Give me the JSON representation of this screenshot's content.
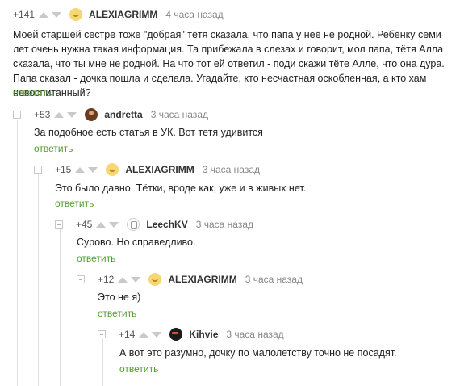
{
  "comments": [
    {
      "rating": "+141",
      "author": "ALEXIAGRIMM",
      "time": "4 часа назад",
      "text": "Моей старшей сестре тоже \"добрая\" тётя сказала, что папа у неё не родной. Ребёнку семи лет очень нужна такая информация. Та прибежала в слезах и говорит, мол папа, тётя Алла сказала, что ты мне не родной. На что тот ей ответил - поди скажи тёте Алле, что она дура. Папа сказал - дочка пошла и сделала. Угадайте, кто несчастная оскобленная, а кто хам невоспитанный?",
      "reply": "ответить"
    },
    {
      "rating": "+53",
      "author": "andretta",
      "time": "3 часа назад",
      "text": "За подобное есть статья в УК. Вот тетя удивится",
      "reply": "ответить"
    },
    {
      "rating": "+15",
      "author": "ALEXIAGRIMM",
      "time": "3 часа назад",
      "text": "Это было давно. Тётки, вроде как, уже и в живых нет.",
      "reply": "ответить"
    },
    {
      "rating": "+45",
      "author": "LeechKV",
      "time": "3 часа назад",
      "text": "Сурово. Но справедливо.",
      "reply": "ответить"
    },
    {
      "rating": "+12",
      "author": "ALEXIAGRIMM",
      "time": "3 часа назад",
      "text": "Это не я)",
      "reply": "ответить"
    },
    {
      "rating": "+14",
      "author": "Kihvie",
      "time": "3 часа назад",
      "text": "А вот это разумно, дочку по малолетству точно не посадят.",
      "reply": "ответить"
    }
  ],
  "icons": {
    "upvote": "arrow-up-icon",
    "downvote": "arrow-down-icon",
    "collapse": "minus-square-icon"
  },
  "colors": {
    "reply_link": "#519f2d",
    "vote_arrow": "#c9c9c9",
    "thread_line": "#e0e0e0"
  }
}
